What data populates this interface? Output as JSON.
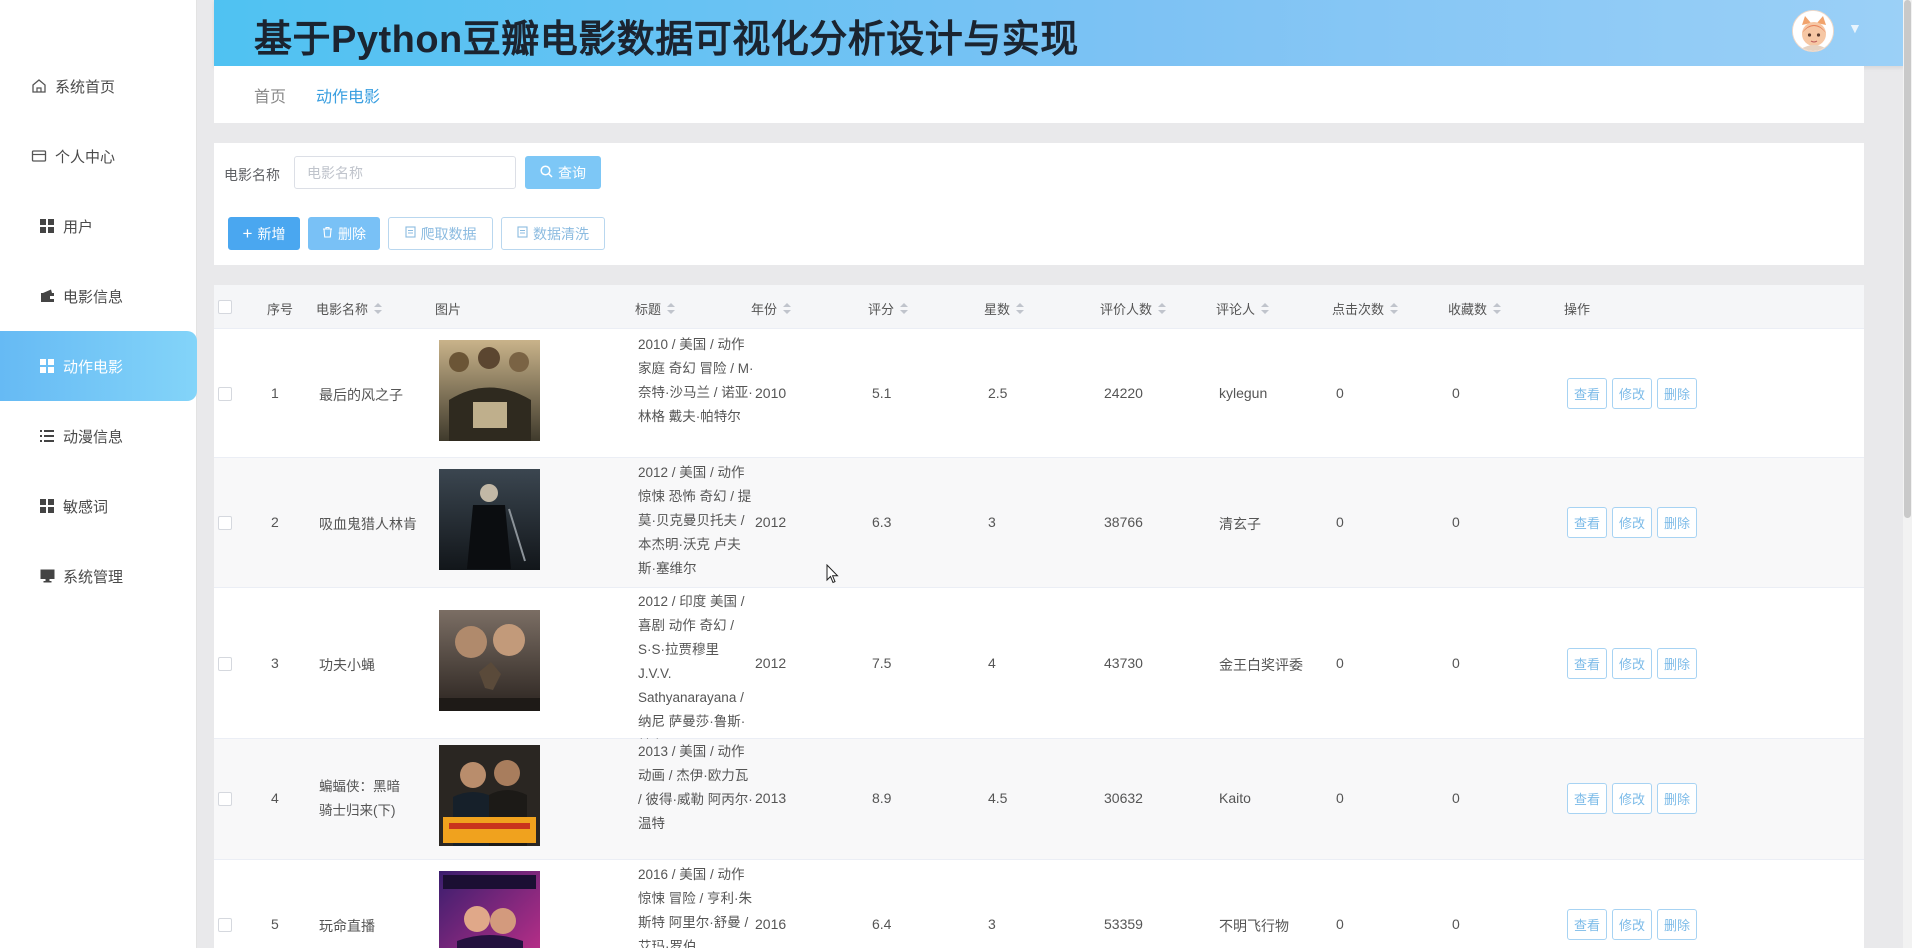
{
  "header": {
    "title": "基于Python豆瓣电影数据可视化分析设计与实现"
  },
  "sidebar": {
    "items": [
      {
        "label": "系统首页",
        "icon": "home-icon"
      },
      {
        "label": "个人中心",
        "icon": "card-icon"
      },
      {
        "label": "用户",
        "icon": "grid-icon"
      },
      {
        "label": "电影信息",
        "icon": "wallet-icon"
      },
      {
        "label": "动作电影",
        "icon": "grid-icon",
        "active": true
      },
      {
        "label": "动漫信息",
        "icon": "list-icon"
      },
      {
        "label": "敏感词",
        "icon": "grid-icon"
      },
      {
        "label": "系统管理",
        "icon": "monitor-icon"
      }
    ]
  },
  "breadcrumb": {
    "home": "首页",
    "current": "动作电影"
  },
  "search": {
    "label": "电影名称",
    "placeholder": "电影名称",
    "query_button": "查询"
  },
  "toolbar": {
    "add": "新增",
    "delete": "删除",
    "crawl": "爬取数据",
    "clean": "数据清洗"
  },
  "table": {
    "columns": [
      "序号",
      "电影名称",
      "图片",
      "标题",
      "年份",
      "评分",
      "星数",
      "评价人数",
      "评论人",
      "点击次数",
      "收藏数",
      "操作"
    ],
    "actions": {
      "view": "查看",
      "edit": "修改",
      "delete": "删除"
    },
    "rows": [
      {
        "index": "1",
        "name": "最后的风之子",
        "title": "2010 / 美国 / 动作 家庭 奇幻 冒险 / M·奈特·沙马兰 / 诺亚·林格 戴夫·帕特尔",
        "year": "2010",
        "score": "5.1",
        "stars": "2.5",
        "raters": "24220",
        "reviewer": "kylegun",
        "clicks": "0",
        "favorites": "0"
      },
      {
        "index": "2",
        "name": "吸血鬼猎人林肯",
        "title": "2012 / 美国 / 动作 惊悚 恐怖 奇幻 / 提莫·贝克曼贝托夫 / 本杰明·沃克 卢夫斯·塞维尔",
        "year": "2012",
        "score": "6.3",
        "stars": "3",
        "raters": "38766",
        "reviewer": "清玄子",
        "clicks": "0",
        "favorites": "0"
      },
      {
        "index": "3",
        "name": "功夫小蝇",
        "title": "2012 / 印度 美国 / 喜剧 动作 奇幻 / S·S·拉贾穆里 J.V.V. Sathyanarayana / 纳尼 萨曼莎·鲁斯·帕布",
        "year": "2012",
        "score": "7.5",
        "stars": "4",
        "raters": "43730",
        "reviewer": "金王白奖评委",
        "clicks": "0",
        "favorites": "0"
      },
      {
        "index": "4",
        "name": "蝙蝠侠：黑暗骑士归来(下)",
        "title": "2013 / 美国 / 动作 动画 / 杰伊·欧力瓦 / 彼得·威勒 阿丙尔·温特",
        "year": "2013",
        "score": "8.9",
        "stars": "4.5",
        "raters": "30632",
        "reviewer": "Kaito",
        "clicks": "0",
        "favorites": "0"
      },
      {
        "index": "5",
        "name": "玩命直播",
        "title": "2016 / 美国 / 动作 惊悚 冒险 / 亨利·朱斯特 阿里尔·舒曼 / 艾玛·罗伯",
        "year": "2016",
        "score": "6.4",
        "stars": "3",
        "raters": "53359",
        "reviewer": "不明飞行物",
        "clicks": "0",
        "favorites": "0"
      }
    ]
  },
  "colors": {
    "header_start": "#4fc2f2",
    "header_end": "#9bd0f7",
    "active_menu": "#66baf4",
    "link": "#3a9fe0"
  }
}
